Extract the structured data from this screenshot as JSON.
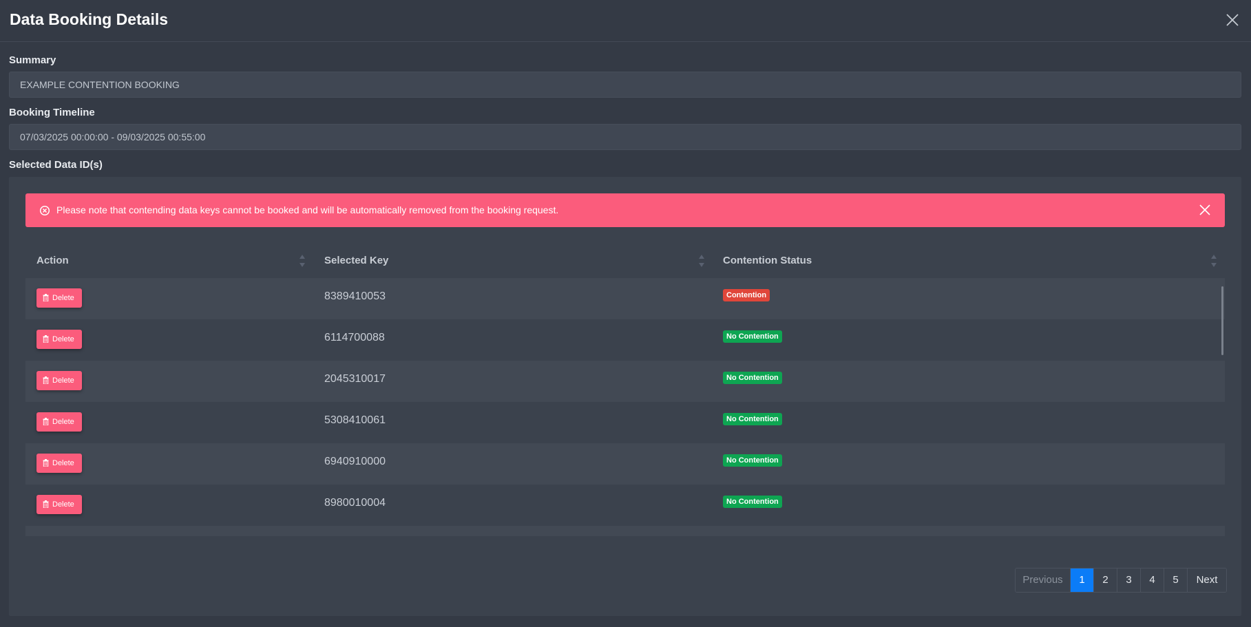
{
  "modal": {
    "title": "Data Booking Details"
  },
  "summary": {
    "label": "Summary",
    "value": "EXAMPLE CONTENTION BOOKING"
  },
  "timeline": {
    "label": "Booking Timeline",
    "value": "07/03/2025 00:00:00 - 09/03/2025 00:55:00"
  },
  "selected": {
    "label": "Selected Data ID(s)"
  },
  "alert": {
    "text": "Please note that contending data keys cannot be booked and will be automatically removed from the booking request."
  },
  "table": {
    "headers": [
      "Action",
      "Selected Key",
      "Contention Status"
    ],
    "delete_label": "Delete",
    "rows": [
      {
        "key": "8389410053",
        "status": "Contention",
        "status_color": "#e0463a"
      },
      {
        "key": "6114700088",
        "status": "No Contention",
        "status_color": "#0ea552"
      },
      {
        "key": "2045310017",
        "status": "No Contention",
        "status_color": "#0ea552"
      },
      {
        "key": "5308410061",
        "status": "No Contention",
        "status_color": "#0ea552"
      },
      {
        "key": "6940910000",
        "status": "No Contention",
        "status_color": "#0ea552"
      },
      {
        "key": "8980010004",
        "status": "No Contention",
        "status_color": "#0ea552"
      }
    ]
  },
  "pagination": {
    "previous": "Previous",
    "pages": [
      "1",
      "2",
      "3",
      "4",
      "5"
    ],
    "active_page": "1",
    "next": "Next"
  },
  "colors": {
    "background": "#343a45",
    "alert": "#fb5c7c",
    "accent": "#0b7cf7",
    "contention": "#e0463a",
    "no_contention": "#0ea552"
  }
}
